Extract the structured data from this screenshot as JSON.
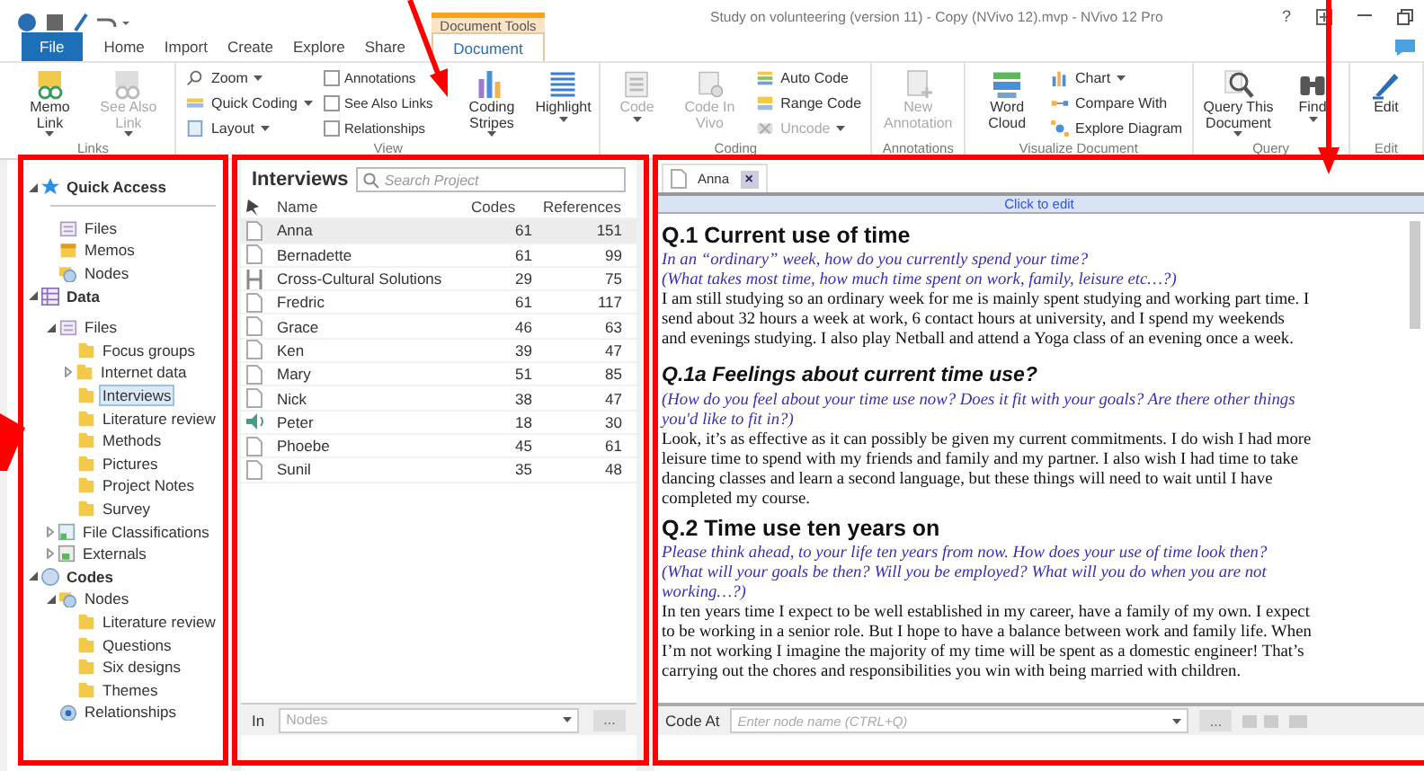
{
  "title_bar": {
    "contextual_label": "Document Tools",
    "title": "Study on volunteering (version 11) - Copy (NVivo 12).mvp - NVivo 12 Pro",
    "help": "?"
  },
  "tabs": [
    {
      "label": "File",
      "kind": "file",
      "selected": false
    },
    {
      "label": "Home",
      "kind": "tab",
      "selected": false
    },
    {
      "label": "Import",
      "kind": "tab",
      "selected": false
    },
    {
      "label": "Create",
      "kind": "tab",
      "selected": false
    },
    {
      "label": "Explore",
      "kind": "tab",
      "selected": false
    },
    {
      "label": "Share",
      "kind": "tab",
      "selected": false
    },
    {
      "label": "Document",
      "kind": "contextual",
      "selected": true
    }
  ],
  "ribbon_groups": [
    {
      "label": "Links",
      "controls": [
        {
          "kind": "large",
          "label": "Memo Link",
          "dropdown": true,
          "disabled": false
        },
        {
          "kind": "large",
          "label": "See Also Link",
          "dropdown": true,
          "disabled": true
        }
      ]
    },
    {
      "label": "View",
      "controls": [
        {
          "kind": "stack",
          "items": [
            {
              "kind": "small",
              "label": "Zoom",
              "dropdown": true,
              "disabled": false
            },
            {
              "kind": "small",
              "label": "Quick Coding",
              "dropdown": true,
              "disabled": false
            },
            {
              "kind": "small",
              "label": "Layout",
              "dropdown": true,
              "disabled": false
            }
          ]
        },
        {
          "kind": "stack",
          "items": [
            {
              "kind": "check",
              "label": "Annotations",
              "checked": false
            },
            {
              "kind": "check",
              "label": "See Also Links",
              "checked": false
            },
            {
              "kind": "check",
              "label": "Relationships",
              "checked": false
            }
          ]
        },
        {
          "kind": "large",
          "label": "Coding Stripes",
          "dropdown": true,
          "disabled": false
        },
        {
          "kind": "large",
          "label": "Highlight",
          "dropdown": true,
          "disabled": false
        }
      ]
    },
    {
      "label": "Coding",
      "controls": [
        {
          "kind": "large",
          "label": "Code",
          "dropdown": true,
          "disabled": true
        },
        {
          "kind": "large",
          "label": "Code In Vivo",
          "dropdown": false,
          "disabled": true
        },
        {
          "kind": "stack",
          "items": [
            {
              "kind": "small",
              "label": "Auto Code",
              "dropdown": false,
              "disabled": false
            },
            {
              "kind": "small",
              "label": "Range Code",
              "dropdown": false,
              "disabled": false
            },
            {
              "kind": "small",
              "label": "Uncode",
              "dropdown": true,
              "disabled": true
            }
          ]
        }
      ]
    },
    {
      "label": "Annotations",
      "controls": [
        {
          "kind": "large",
          "label": "New Annotation",
          "dropdown": false,
          "disabled": true
        }
      ]
    },
    {
      "label": "Visualize Document",
      "controls": [
        {
          "kind": "large",
          "label": "Word Cloud",
          "dropdown": false,
          "disabled": false
        },
        {
          "kind": "stack",
          "items": [
            {
              "kind": "small",
              "label": "Chart",
              "dropdown": true,
              "disabled": false
            },
            {
              "kind": "small",
              "label": "Compare With",
              "dropdown": false,
              "disabled": false
            },
            {
              "kind": "small",
              "label": "Explore Diagram",
              "dropdown": false,
              "disabled": false
            }
          ]
        }
      ]
    },
    {
      "label": "Query",
      "controls": [
        {
          "kind": "large",
          "label": "Query This Document",
          "dropdown": true,
          "disabled": false
        },
        {
          "kind": "large",
          "label": "Find",
          "dropdown": true,
          "disabled": false
        }
      ]
    },
    {
      "label": "Edit",
      "controls": [
        {
          "kind": "large",
          "label": "Edit",
          "dropdown": false,
          "disabled": false
        }
      ]
    }
  ],
  "navigation": [
    {
      "label": "Quick Access",
      "kind": "star",
      "expanded": true,
      "selected": false,
      "children": [
        {
          "label": "Files",
          "kind": "files",
          "selected": false
        },
        {
          "label": "Memos",
          "kind": "memos",
          "selected": false
        },
        {
          "label": "Nodes",
          "kind": "nodes",
          "selected": false
        }
      ]
    },
    {
      "label": "Data",
      "kind": "data",
      "expanded": true,
      "selected": false,
      "children": [
        {
          "label": "Files",
          "kind": "files",
          "expanded": true,
          "selected": false,
          "children": [
            {
              "label": "Focus groups",
              "kind": "folder",
              "selected": false
            },
            {
              "label": "Internet data",
              "kind": "folder",
              "expanded": false,
              "selected": false
            },
            {
              "label": "Interviews",
              "kind": "folder",
              "selected": true
            },
            {
              "label": "Literature review",
              "kind": "folder",
              "selected": false
            },
            {
              "label": "Methods",
              "kind": "folder",
              "selected": false
            },
            {
              "label": "Pictures",
              "kind": "folder",
              "selected": false
            },
            {
              "label": "Project Notes",
              "kind": "folder",
              "selected": false
            },
            {
              "label": "Survey",
              "kind": "folder",
              "selected": false
            }
          ]
        },
        {
          "label": "File Classifications",
          "kind": "classifications",
          "expanded": false,
          "selected": false
        },
        {
          "label": "Externals",
          "kind": "externals",
          "expanded": false,
          "selected": false
        }
      ]
    },
    {
      "label": "Codes",
      "kind": "codes",
      "expanded": true,
      "selected": false,
      "children": [
        {
          "label": "Nodes",
          "kind": "nodes",
          "expanded": true,
          "selected": false,
          "children": [
            {
              "label": "Literature review",
              "kind": "folder",
              "selected": false
            },
            {
              "label": "Questions",
              "kind": "folder",
              "selected": false
            },
            {
              "label": "Six designs",
              "kind": "folder",
              "selected": false
            },
            {
              "label": "Themes",
              "kind": "folder",
              "selected": false
            }
          ]
        },
        {
          "label": "Relationships",
          "kind": "relationships",
          "selected": false
        }
      ]
    }
  ],
  "list": {
    "title": "Interviews",
    "search": {
      "placeholder": "Search Project"
    },
    "columns": [
      "Name",
      "Codes",
      "References"
    ],
    "rows": [
      {
        "kind": "document",
        "name": "Anna",
        "codes": "61",
        "references": "151",
        "selected": true
      },
      {
        "kind": "document",
        "name": "Bernadette",
        "codes": "61",
        "references": "99",
        "selected": false
      },
      {
        "kind": "video",
        "name": "Cross-Cultural Solutions",
        "codes": "29",
        "references": "75",
        "selected": false
      },
      {
        "kind": "document",
        "name": "Fredric",
        "codes": "61",
        "references": "117",
        "selected": false
      },
      {
        "kind": "document",
        "name": "Grace",
        "codes": "46",
        "references": "63",
        "selected": false
      },
      {
        "kind": "document",
        "name": "Ken",
        "codes": "39",
        "references": "47",
        "selected": false
      },
      {
        "kind": "document",
        "name": "Mary",
        "codes": "51",
        "references": "85",
        "selected": false
      },
      {
        "kind": "document",
        "name": "Nick",
        "codes": "38",
        "references": "47",
        "selected": false
      },
      {
        "kind": "audio",
        "name": "Peter",
        "codes": "18",
        "references": "30",
        "selected": false
      },
      {
        "kind": "document",
        "name": "Phoebe",
        "codes": "45",
        "references": "61",
        "selected": false
      },
      {
        "kind": "document",
        "name": "Sunil",
        "codes": "35",
        "references": "48",
        "selected": false
      }
    ],
    "footer": {
      "label": "In",
      "placeholder": "Nodes",
      "button": "..."
    }
  },
  "document": {
    "tab": "Anna",
    "close": "×",
    "edit_bar": "Click to edit",
    "blocks": [
      {
        "kind": "heading",
        "text": "Q.1 Current use of time"
      },
      {
        "kind": "prompt",
        "text": "In an “ordinary” week, how do you currently spend your time?"
      },
      {
        "kind": "prompt",
        "text": "(What takes most time, how much time spent on work, family, leisure etc…?)"
      },
      {
        "kind": "body",
        "text": "I am still studying so an ordinary week for me is mainly spent studying and working part time. I send about 32 hours a week at work, 6 contact hours at university, and I spend my weekends and evenings studying. I also play Netball and attend a Yoga class of an evening once a week."
      },
      {
        "kind": "subheading",
        "text": "Q.1a Feelings about current time use?"
      },
      {
        "kind": "prompt",
        "text": "(How do you feel about your time use now? Does it fit with your goals? Are there other things you'd like to fit in?)"
      },
      {
        "kind": "body",
        "text": "Look, it’s as effective as it can possibly be given my current commitments. I do wish I had more leisure time to spend with my friends and family and my partner. I also wish I had time to take dancing classes and learn a second language, but these things will need to wait until I have completed my course."
      },
      {
        "kind": "heading",
        "text": "Q.2 Time use ten years on"
      },
      {
        "kind": "prompt",
        "text": "Please think ahead, to your life ten years from now. How does your use of time look then?"
      },
      {
        "kind": "prompt",
        "text": "(What will your goals be then? Will you be employed?  What will you do when you are not working…?)"
      },
      {
        "kind": "body",
        "text": "In ten years time I expect to be well established in my career, have a family of my own. I expect to be working in a senior role. But I hope to have a balance between work and family life. When I’m not working I imagine the majority of my time will be spent as a domestic engineer! That’s carrying out the chores and responsibilities you win with being married with children."
      }
    ],
    "code_bar": {
      "label": "Code At",
      "placeholder": "Enter node name (CTRL+Q)",
      "button": "..."
    }
  }
}
